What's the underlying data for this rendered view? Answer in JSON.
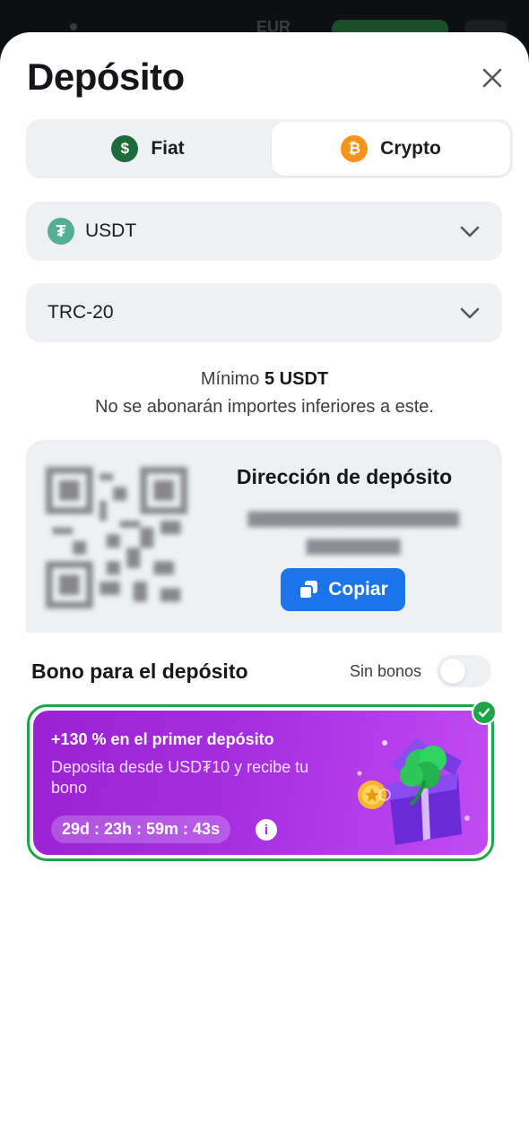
{
  "backdrop": {
    "currency": "EUR"
  },
  "sheet": {
    "title": "Depósito",
    "tabs": [
      {
        "label": "Fiat",
        "icon": "dollar-coin-icon",
        "symbol": "$",
        "color": "#1d6b3a"
      },
      {
        "label": "Crypto",
        "icon": "bitcoin-coin-icon",
        "symbol": "₿",
        "color": "#f7931a",
        "selected": true
      }
    ],
    "currency_select": {
      "label": "USDT",
      "icon": "tether-icon",
      "symbol": "₮",
      "color": "#53ae94"
    },
    "network_select": {
      "label": "TRC-20"
    },
    "minimum": {
      "prefix": "Mínimo",
      "amount": "5 USDT",
      "note": "No se abonarán importes inferiores a este."
    },
    "deposit_address": {
      "title": "Dirección de depósito",
      "copy_label": "Copiar"
    },
    "bonus": {
      "heading": "Bono para el depósito",
      "toggle_label": "Sin bonos",
      "toggle_on": false,
      "card": {
        "headline": "+130 % en el primer depósito",
        "description": "Deposita desde USD₮10 y recibe tu bono",
        "timer": "29d : 23h : 59m : 43s",
        "info_symbol": "i",
        "selected": true
      }
    }
  },
  "colors": {
    "accent_blue": "#1b74ea",
    "success_green": "#1ea54a",
    "bonus_purple": "#a52ee0"
  }
}
